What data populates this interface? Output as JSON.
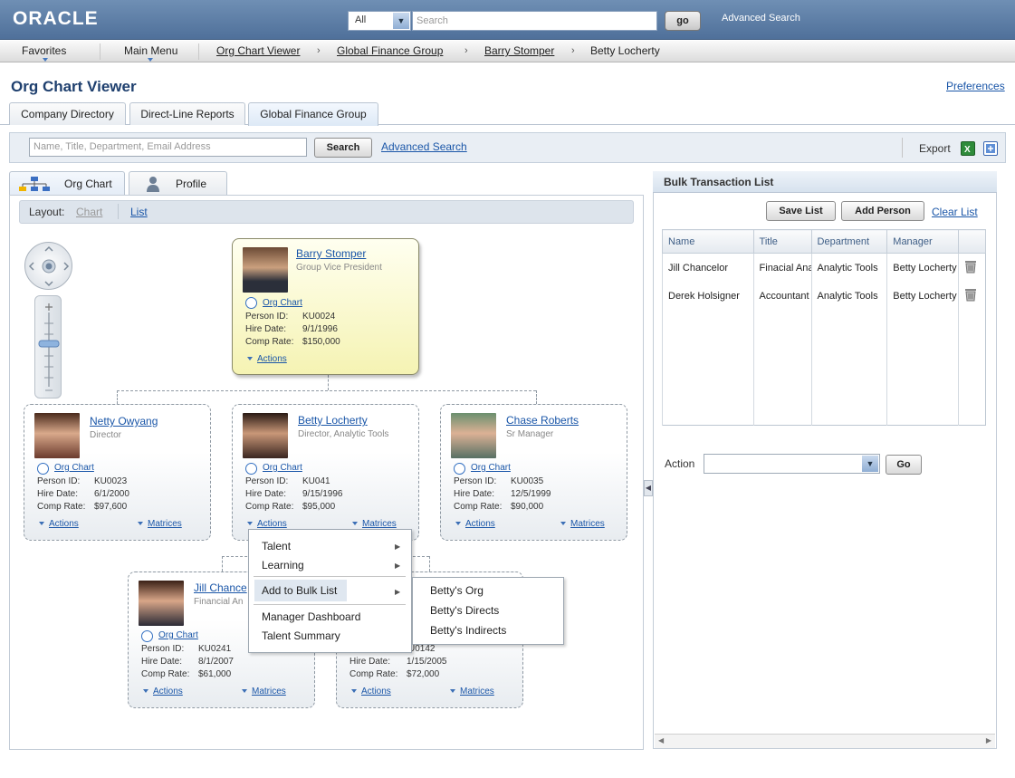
{
  "header": {
    "logo": "ORACLE",
    "scope_value": "All",
    "search_placeholder": "Search",
    "go_label": "go",
    "advanced_search": "Advanced Search"
  },
  "nav": {
    "favorites": "Favorites",
    "main_menu": "Main Menu",
    "breadcrumbs": [
      "Org Chart Viewer",
      "Global Finance Group",
      "Barry Stomper",
      "Betty Locherty"
    ]
  },
  "page": {
    "title": "Org Chart Viewer",
    "preferences": "Preferences",
    "tabs": [
      "Company Directory",
      "Direct-Line Reports",
      "Global Finance Group"
    ]
  },
  "searchbar": {
    "placeholder": "Name, Title, Department, Email Address",
    "search_label": "Search",
    "advanced_search": "Advanced Search",
    "export_label": "Export"
  },
  "view_tabs": [
    "Org Chart",
    "Profile"
  ],
  "layout": {
    "label": "Layout:",
    "chart": "Chart",
    "list": "List"
  },
  "card_labels": {
    "org_chart": "Org Chart",
    "person_id": "Person ID:",
    "hire_date": "Hire Date:",
    "comp_rate": "Comp Rate:",
    "actions": "Actions",
    "matrices": "Matrices"
  },
  "people": {
    "barry": {
      "name": "Barry Stomper",
      "title": "Group Vice President",
      "person_id": "KU0024",
      "hire_date": "9/1/1996",
      "comp_rate": "$150,000"
    },
    "netty": {
      "name": "Netty Owyang",
      "title": "Director",
      "person_id": "KU0023",
      "hire_date": "6/1/2000",
      "comp_rate": "$97,600"
    },
    "betty": {
      "name": "Betty Locherty",
      "title": "Director, Analytic Tools",
      "person_id": "KU041",
      "hire_date": "9/15/1996",
      "comp_rate": "$95,000"
    },
    "chase": {
      "name": "Chase Roberts",
      "title": "Sr Manager",
      "person_id": "KU0035",
      "hire_date": "12/5/1999",
      "comp_rate": "$90,000"
    },
    "jill": {
      "name": "Jill Chance",
      "title": "Financial An",
      "person_id": "KU0241",
      "hire_date": "8/1/2007",
      "comp_rate": "$61,000"
    },
    "fifth": {
      "person_id": "U0142",
      "hire_date": "1/15/2005",
      "comp_rate": "$72,000"
    }
  },
  "actions_menu": {
    "items": [
      "Talent",
      "Learning",
      "Add to Bulk List",
      "Manager Dashboard",
      "Talent Summary"
    ]
  },
  "submenu": {
    "items": [
      "Betty's Org",
      "Betty's Directs",
      "Betty's Indirects"
    ]
  },
  "bulk": {
    "title": "Bulk Transaction List",
    "save_list": "Save List",
    "add_person": "Add Person",
    "clear_list": "Clear List",
    "columns": [
      "Name",
      "Title",
      "Department",
      "Manager"
    ],
    "rows": [
      [
        "Jill Chancelor",
        "Finacial Ana",
        "Analytic Tools",
        "Betty Locherty"
      ],
      [
        "Derek Holsigner",
        "Accountant",
        "Analytic Tools",
        "Betty Locherty"
      ]
    ],
    "action_label": "Action",
    "action_value": "",
    "go_label": "Go"
  }
}
